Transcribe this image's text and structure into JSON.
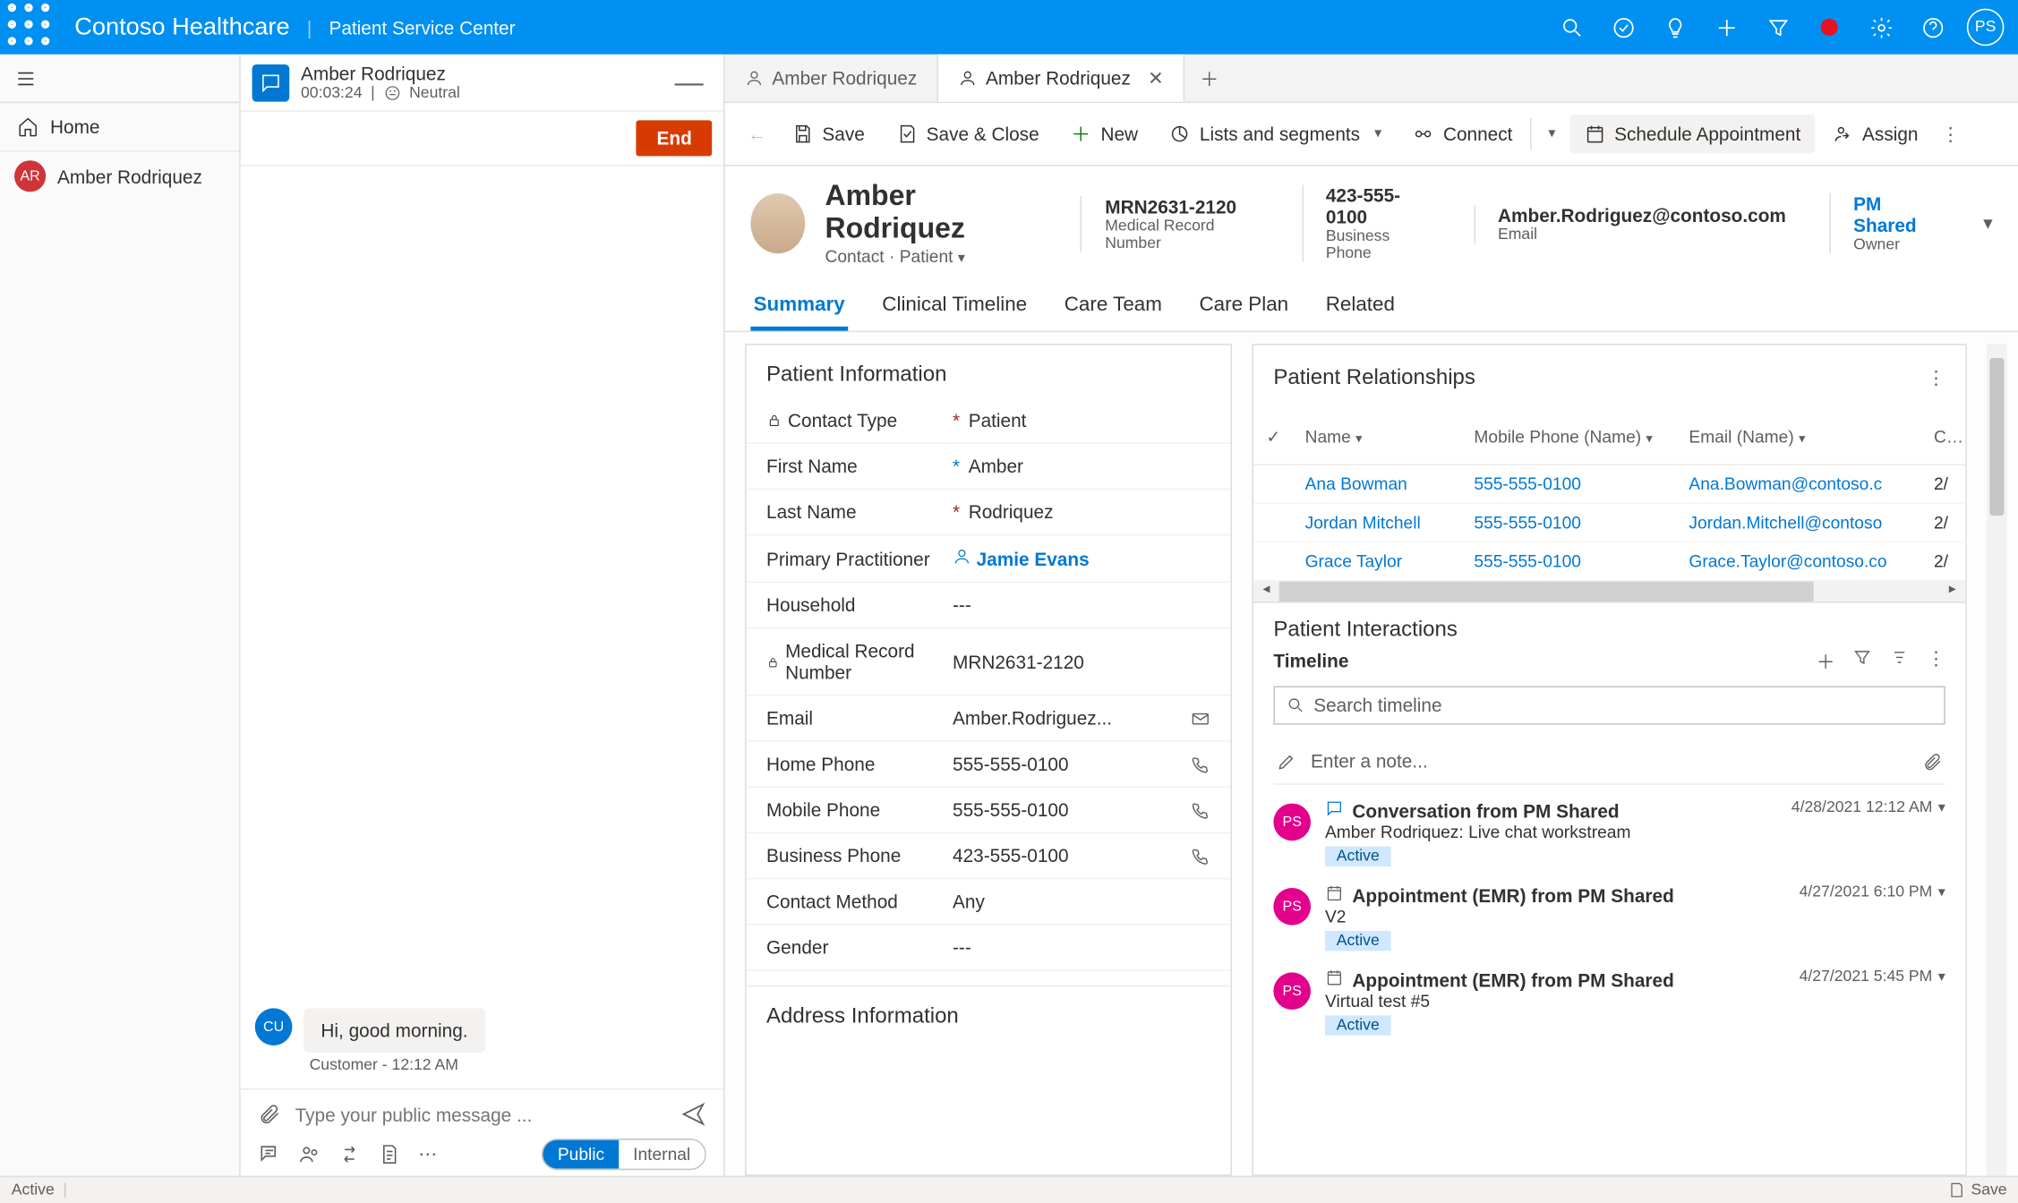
{
  "topbar": {
    "brand": "Contoso Healthcare",
    "sub": "Patient Service Center",
    "avatar": "PS"
  },
  "leftnav": {
    "home": "Home",
    "session": "Amber Rodriquez",
    "session_initials": "AR"
  },
  "chat": {
    "header_name": "Amber Rodriquez",
    "timer": "00:03:24",
    "sentiment": "Neutral",
    "end": "End",
    "minimize": "—",
    "bubble": "Hi, good morning.",
    "cu": "CU",
    "meta": "Customer - 12:12 AM",
    "compose_placeholder": "Type your public message ...",
    "tab_public": "Public",
    "tab_internal": "Internal"
  },
  "tabs": {
    "t1": "Amber Rodriquez",
    "t2": "Amber Rodriquez"
  },
  "cmd": {
    "save": "Save",
    "saveclose": "Save & Close",
    "new": "New",
    "lists": "Lists and segments",
    "connect": "Connect",
    "schedule": "Schedule Appointment",
    "assign": "Assign"
  },
  "rec": {
    "name": "Amber Rodriquez",
    "sub1": "Contact",
    "sub2": "Patient",
    "mrn_v": "MRN2631-2120",
    "mrn_k": "Medical Record Number",
    "biz_v": "423-555-0100",
    "biz_k": "Business Phone",
    "email_v": "Amber.Rodriguez@contoso.com",
    "email_k": "Email",
    "owner_v": "PM Shared",
    "owner_k": "Owner"
  },
  "rectabs": {
    "t1": "Summary",
    "t2": "Clinical Timeline",
    "t3": "Care Team",
    "t4": "Care Plan",
    "t5": "Related"
  },
  "pi": {
    "title": "Patient Information",
    "contacttype_l": "Contact Type",
    "contacttype_v": "Patient",
    "first_l": "First Name",
    "first_v": "Amber",
    "last_l": "Last Name",
    "last_v": "Rodriquez",
    "pract_l": "Primary Practitioner",
    "pract_v": "Jamie Evans",
    "house_l": "Household",
    "house_v": "---",
    "mrn_l": "Medical Record Number",
    "mrn_v": "MRN2631-2120",
    "email_l": "Email",
    "email_v": "Amber.Rodriguez...",
    "home_l": "Home Phone",
    "home_v": "555-555-0100",
    "mob_l": "Mobile Phone",
    "mob_v": "555-555-0100",
    "biz_l": "Business Phone",
    "biz_v": "423-555-0100",
    "method_l": "Contact Method",
    "method_v": "Any",
    "gender_l": "Gender",
    "gender_v": "---",
    "addr_title": "Address Information"
  },
  "rel": {
    "title": "Patient Relationships",
    "h_name": "Name",
    "h_mob": "Mobile Phone (Name)",
    "h_email": "Email (Name)",
    "h_cr": "Cre",
    "rows": [
      {
        "name": "Ana Bowman",
        "mob": "555-555-0100",
        "email": "Ana.Bowman@contoso.c",
        "cr": "2/"
      },
      {
        "name": "Jordan Mitchell",
        "mob": "555-555-0100",
        "email": "Jordan.Mitchell@contoso",
        "cr": "2/"
      },
      {
        "name": "Grace Taylor",
        "mob": "555-555-0100",
        "email": "Grace.Taylor@contoso.co",
        "cr": "2/"
      }
    ]
  },
  "inter": {
    "title": "Patient Interactions",
    "timeline": "Timeline",
    "search": "Search timeline",
    "note": "Enter a note...",
    "items": [
      {
        "title": "Conversation from PM Shared",
        "sub": "Amber Rodriquez: Live chat workstream",
        "badge": "Active",
        "time": "4/28/2021 12:12 AM"
      },
      {
        "title": "Appointment (EMR) from PM Shared",
        "sub": "V2",
        "badge": "Active",
        "time": "4/27/2021 6:10 PM"
      },
      {
        "title": "Appointment (EMR) from PM Shared",
        "sub": "Virtual test #5",
        "badge": "Active",
        "time": "4/27/2021 5:45 PM"
      }
    ],
    "ps": "PS"
  },
  "status": {
    "active": "Active",
    "save": "Save"
  }
}
